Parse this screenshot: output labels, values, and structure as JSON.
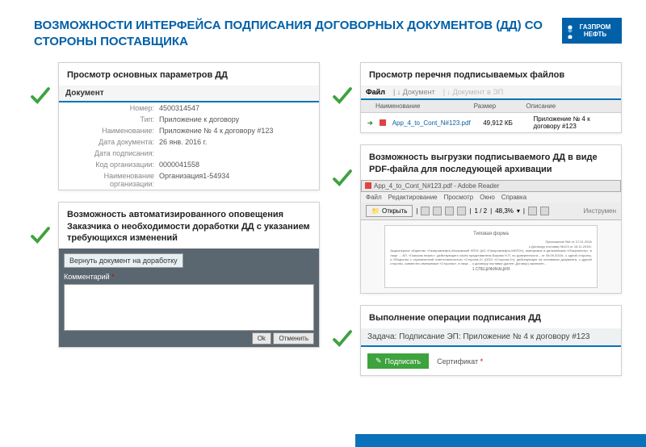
{
  "title": "ВОЗМОЖНОСТИ ИНТЕРФЕЙСА ПОДПИСАНИЯ ДОГОВОРНЫХ ДОКУМЕНТОВ (ДД) СО СТОРОНЫ ПОСТАВЩИКА",
  "logo": {
    "l1": "ГАЗПРОМ",
    "l2": "НЕФТЬ"
  },
  "left": {
    "params": {
      "title": "Просмотр основных параметров ДД",
      "section": "Документ",
      "rows": [
        {
          "l": "Номер",
          "v": "4500314547"
        },
        {
          "l": "Тип",
          "v": "Приложение к договору"
        },
        {
          "l": "Наименование",
          "v": "Приложение № 4 к договору #123"
        },
        {
          "l": "Дата документа",
          "v": "26 янв. 2016 г."
        },
        {
          "l": "Дата подписания",
          "v": ""
        },
        {
          "l": "Код организации",
          "v": "0000041558"
        },
        {
          "l": "Наименование организации",
          "v": "Организация1-54934"
        }
      ]
    },
    "rework": {
      "title": "Возможность автоматизированного оповещения Заказчика о необходимости доработки ДД с указанием требующихся изменений",
      "hdr": "Вернуть документ на доработку",
      "lbl": "Комментарий",
      "cancel": "Отменить"
    }
  },
  "right": {
    "files": {
      "title": "Просмотр перечня подписываемых файлов",
      "tabs": {
        "a": "Файл",
        "b": "Документ",
        "c": "Документ в ЭП"
      },
      "cols": {
        "c1": "Наименование",
        "c2": "Размер",
        "c3": "Описание"
      },
      "row": {
        "name": "App_4_to_Cont_N#123.pdf",
        "size": "49,912 КБ",
        "desc": "Приложение № 4 к договору #123"
      }
    },
    "pdf": {
      "title": "Возможность выгрузки подписываемого ДД в виде PDF-файла для последующей архивации",
      "wt": "App_4_to_Cont_N#123.pdf - Adobe Reader",
      "menu": {
        "m1": "Файл",
        "m2": "Редактирование",
        "m3": "Просмотр",
        "m4": "Окно",
        "m5": "Справка"
      },
      "open": "Открыть",
      "pg": "1 / 2",
      "zoom": "48,3%",
      "tool": "Инструмен",
      "doc": {
        "t": "Типовая форма",
        "s": "Приложение №4 от 27.01.2016",
        "s2": "к Договору поставки №123 от 16.11.2015г.",
        "b": "Акционерное общество «Газпромнефть-Московский НПЗ» (АО «Газпромнефть-МНПЗ»), именуемое в дальнейшем «Покупатель», в лице ... АП. «Газпром нефть», действующего через представителя Быкова Н.П. по доверенности... от 09.09.2015г., с одной стороны, и Общество с ограниченной ответственностью «Сторона-2» (ООО «Сторона-2»), действующее на основании документа, с другой стороны, совместно именуемые «Стороны», в лице ... к договору поставки (далее: Договор) заключен...",
        "sp": "1.СПЕЦИФИКАЦИЯ"
      }
    },
    "sign": {
      "title": "Выполнение операции подписания ДД",
      "task": "Задача: Подписание ЭП: Приложение № 4 к договору #123",
      "btn": "Подписать",
      "cert": "Сертификат"
    }
  }
}
